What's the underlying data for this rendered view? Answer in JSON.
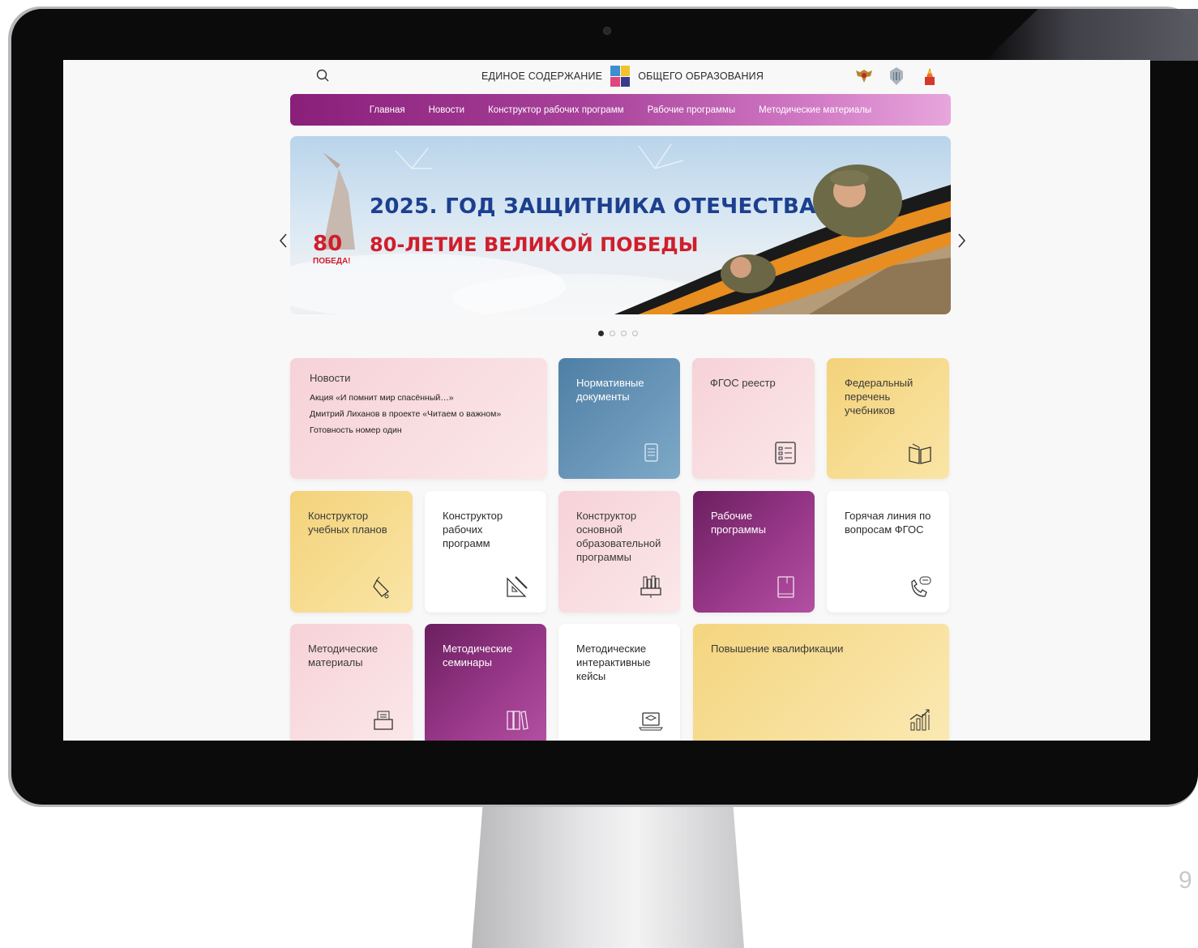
{
  "header": {
    "brand_left": "ЕДИНОЕ СОДЕРЖАНИЕ",
    "brand_right": "ОБЩЕГО ОБРАЗОВАНИЯ",
    "search_icon": "search-icon",
    "emblems": [
      "eagle-emblem-icon",
      "ministry-emblem-icon",
      "institute-emblem-icon"
    ]
  },
  "nav": {
    "items": [
      "Главная",
      "Новости",
      "Конструктор рабочих программ",
      "Рабочие программы",
      "Методические материалы"
    ]
  },
  "banner": {
    "title": "2025. ГОД ЗАЩИТНИКА ОТЕЧЕСТВА",
    "subtitle": "80-ЛЕТИЕ ВЕЛИКОЙ ПОБЕДЫ",
    "badge_number": "80",
    "badge_word": "ПОБЕДА!",
    "slides_total": 4,
    "slide_active": 1
  },
  "tiles": {
    "news": {
      "title": "Новости",
      "items": [
        "Акция «И помнит мир спасённый…»",
        "Дмитрий Лиханов в проекте «Читаем о важном»",
        "Готовность номер один"
      ]
    },
    "normative": {
      "title": "Нормативные документы",
      "icon": "document-icon"
    },
    "fgos_registry": {
      "title": "ФГОС реестр",
      "icon": "checklist-icon"
    },
    "textbooks": {
      "title": "Федеральный перечень учебников",
      "icon": "open-book-icon"
    },
    "curriculum_builder": {
      "title": "Конструктор учебных планов",
      "icon": "bell-icon"
    },
    "program_builder": {
      "title": "Конструктор рабочих программ",
      "icon": "ruler-pencil-icon"
    },
    "basic_program_builder": {
      "title": "Конструктор основной образовательной программы",
      "icon": "books-monitor-icon"
    },
    "work_programs": {
      "title": "Рабочие программы",
      "icon": "notebook-icon"
    },
    "hotline": {
      "title": "Горячая линия по вопросам ФГОС",
      "icon": "phone-chat-icon"
    },
    "methodical_materials": {
      "title": "Методические материалы",
      "icon": "inbox-tray-icon"
    },
    "methodical_seminars": {
      "title": "Методические семинары",
      "icon": "bookshelf-icon"
    },
    "interactive_cases": {
      "title": "Методические интерактивные кейсы",
      "icon": "laptop-cap-icon"
    },
    "qualification": {
      "title": "Повышение квалификации",
      "icon": "growth-chart-icon"
    }
  },
  "slide_page_number": "9",
  "colors": {
    "nav_start": "#8a1f7a",
    "nav_end": "#e7a6dc",
    "banner_title": "#1c3f8e",
    "banner_subtitle": "#d01e2b"
  }
}
